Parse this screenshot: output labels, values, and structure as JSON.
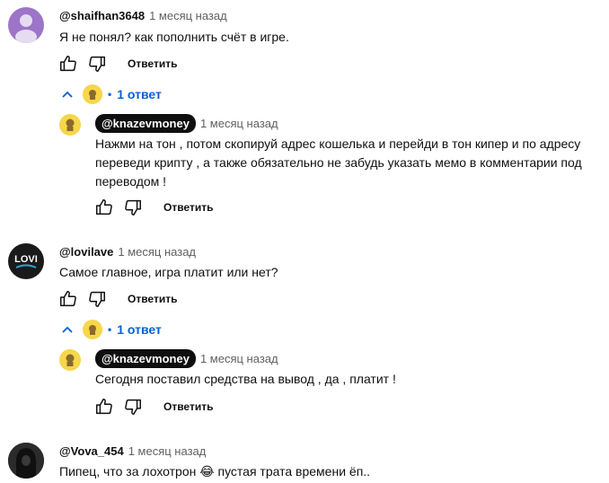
{
  "actions": {
    "reply_label": "Ответить"
  },
  "threads": [
    {
      "author": "@shaifhan3648",
      "time": "1 месяц назад",
      "text": "Я не понял? как пополнить счёт в игре.",
      "replies_label": "1 ответ",
      "reply": {
        "author": "@knazevmoney",
        "time": "1 месяц назад",
        "text_lines": [
          "Нажми на тон , потом скопируй адрес кошелька и перейди в тон кипер и по адресу",
          "переведи крипту , а также обязательно не забудь указать мемо в комментарии под",
          "переводом !"
        ]
      }
    },
    {
      "author": "@lovilave",
      "avatar_text": "LOVI",
      "time": "1 месяц назад",
      "text": "Самое главное, игра платит или нет?",
      "replies_label": "1 ответ",
      "reply": {
        "author": "@knazevmoney",
        "time": "1 месяц назад",
        "text_lines": [
          "Сегодня поставил средства на вывод , да , платит !"
        ]
      }
    },
    {
      "author": "@Vova_454",
      "time": "1 месяц назад",
      "text_before_emoji": "Пипец, что за лохотрон",
      "emoji": "😂",
      "text_after_emoji": " пустая трата времени ёп.."
    }
  ],
  "colors": {
    "link": "#065fd4",
    "muted": "#606060",
    "text": "#0f0f0f"
  },
  "icons": [
    "thumbs-up-icon",
    "thumbs-down-icon",
    "chevron-up-icon"
  ]
}
